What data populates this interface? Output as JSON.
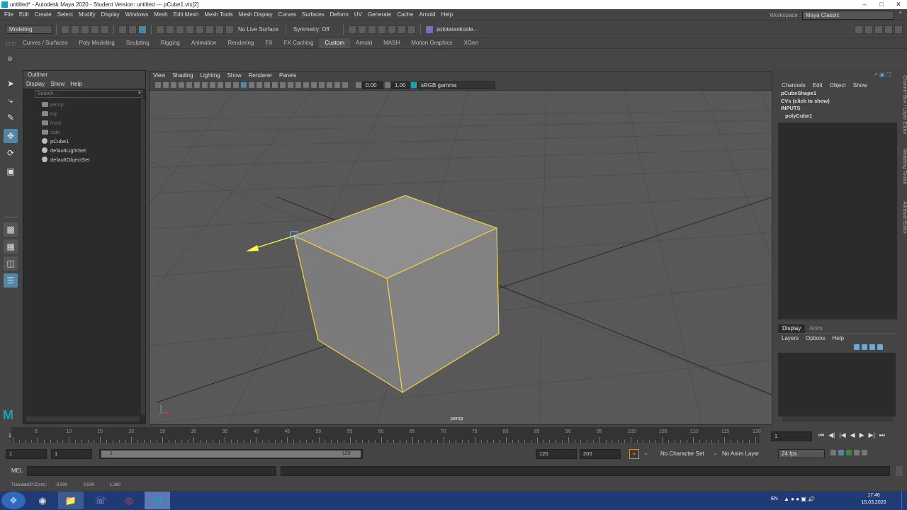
{
  "title": "untitled* - Autodesk Maya 2020 - Student Version: untitled   ---   pCube1.vtx[2]",
  "menus": [
    "File",
    "Edit",
    "Create",
    "Select",
    "Modify",
    "Display",
    "Windows",
    "Mesh",
    "Edit Mesh",
    "Mesh Tools",
    "Mesh Display",
    "Curves",
    "Surfaces",
    "Deform",
    "UV",
    "Generate",
    "Cache",
    "Arnold",
    "Help"
  ],
  "workspace": {
    "label": "Workspace :",
    "value": "Maya Classic"
  },
  "status": {
    "mode": "Modeling",
    "live_surface": "No Live Surface",
    "symmetry": "Symmetry: Off",
    "user": "zolotarenkoole..."
  },
  "shelf_tabs": [
    "Curves / Surfaces",
    "Poly Modeling",
    "Sculpting",
    "Rigging",
    "Animation",
    "Rendering",
    "FX",
    "FX Caching",
    "Custom",
    "Arnold",
    "MASH",
    "Motion Graphics",
    "XGen"
  ],
  "shelf_active": "Custom",
  "outliner": {
    "title": "Outliner",
    "menus": [
      "Display",
      "Show",
      "Help"
    ],
    "search_placeholder": "Search...",
    "items": [
      {
        "label": "persp",
        "dim": true,
        "icon": "camera-icon"
      },
      {
        "label": "top",
        "dim": true,
        "icon": "camera-icon"
      },
      {
        "label": "front",
        "dim": true,
        "icon": "camera-icon"
      },
      {
        "label": "side",
        "dim": true,
        "icon": "camera-icon"
      },
      {
        "label": "pCube1",
        "dim": false,
        "icon": "mesh-icon"
      },
      {
        "label": "defaultLightSet",
        "dim": false,
        "icon": "set-icon"
      },
      {
        "label": "defaultObjectSet",
        "dim": false,
        "icon": "set-icon"
      }
    ]
  },
  "viewport": {
    "menus": [
      "View",
      "Shading",
      "Lighting",
      "Show",
      "Renderer",
      "Panels"
    ],
    "exposure": "0.00",
    "gamma": "1.00",
    "color_space": "sRGB gamma",
    "camera_label": "persp"
  },
  "channel_box": {
    "menus": [
      "Channels",
      "Edit",
      "Object",
      "Show"
    ],
    "items": [
      "pCubeShape1",
      "CVs (click to show)",
      "INPUTS",
      "polyCube1"
    ]
  },
  "layer_editor": {
    "tabs": [
      "Display",
      "Anim"
    ],
    "menus": [
      "Layers",
      "Options",
      "Help"
    ]
  },
  "side_tabs": [
    "Channel Box / Layer Editor",
    "Modeling Toolkit",
    "Attribute Editor"
  ],
  "timeline": {
    "ticks": [
      1,
      5,
      10,
      15,
      20,
      25,
      30,
      35,
      40,
      45,
      50,
      55,
      60,
      65,
      70,
      75,
      80,
      85,
      90,
      95,
      100,
      105,
      110,
      115,
      120
    ],
    "current_frame": "1"
  },
  "range": {
    "start": "1",
    "playback_start": "1",
    "slider_start": "1",
    "slider_end": "120",
    "end": "120",
    "anim_end": "200",
    "character_set": "No Character Set",
    "anim_layer": "No Anim Layer",
    "fps": "24 fps"
  },
  "command": {
    "lang": "MEL"
  },
  "help_line": {
    "label": "TranslateXYZ(cm):",
    "x": "-0.500",
    "y": "0.500",
    "z": "1.260"
  },
  "taskbar": {
    "lang": "EN",
    "time": "17:46",
    "date": "15.03.2020"
  },
  "colors": {
    "accent": "#5285a6",
    "selection": "#ffff3a",
    "taskbar": "#1f3a74"
  }
}
